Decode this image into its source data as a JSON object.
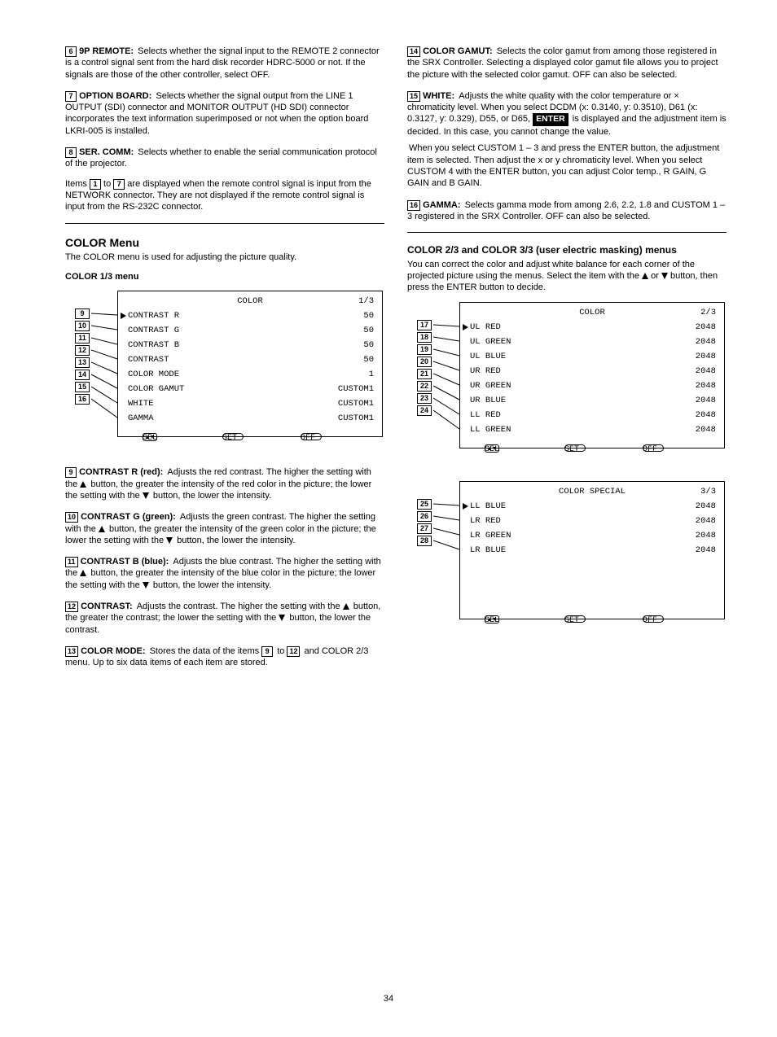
{
  "page_number": "34",
  "left": {
    "item6": {
      "num": "6",
      "lead": "9P REMOTE:",
      "body": "Selects whether the signal input to the REMOTE 2 connector is a control signal sent from the hard disk recorder HDRC-5000 or not. If the signals are those of the other controller, select OFF."
    },
    "item7": {
      "num": "7",
      "lead": "OPTION BOARD:",
      "body": "Selects whether the signal output from the LINE 1 OUTPUT (SDI) connector and MONITOR OUTPUT (HD SDI) connector incorporates the text information superimposed or not when the option board LKRI-005 is installed."
    },
    "item8": {
      "num": "8",
      "lead": "SER. COMM:",
      "body": "Selects whether to enable the serial communication protocol of the projector."
    },
    "item8_note": "Items [1] to [7] are displayed when the remote control signal is input from the NETWORK connector. They are not displayed if the remote control signal is input from the RS-232C connector.",
    "boxref1": "1",
    "boxref7": "7"
  },
  "section_color": {
    "heading": "COLOR Menu",
    "sub": "COLOR 1/3 menu",
    "note": "The COLOR menu is used for adjusting the picture quality."
  },
  "menu1": {
    "title": "COLOR",
    "page": "1/3",
    "rows": [
      {
        "num": "9",
        "k": "CONTRAST R",
        "v": "50"
      },
      {
        "num": "10",
        "k": "CONTRAST G",
        "v": "50"
      },
      {
        "num": "11",
        "k": "CONTRAST B",
        "v": "50"
      },
      {
        "num": "12",
        "k": "CONTRAST",
        "v": "50"
      },
      {
        "num": "13",
        "k": "COLOR MODE",
        "v": "1"
      },
      {
        "num": "14",
        "k": "COLOR GAMUT",
        "v": "CUSTOM1"
      },
      {
        "num": "15",
        "k": "WHITE",
        "v": "CUSTOM1"
      },
      {
        "num": "16",
        "k": "GAMMA",
        "v": "CUSTOM1"
      }
    ],
    "bottom": {
      "sel": "SEL",
      "set": "SET",
      "off": "OFF"
    }
  },
  "item9": {
    "num": "9",
    "lead": "CONTRAST R (red):",
    "body": "Adjusts the red contrast. The higher the setting with the ",
    "body2": " button, the greater the intensity of the red color in the picture; the lower the setting with the ",
    "body3": " button, the lower the intensity."
  },
  "item10": {
    "num": "10",
    "lead": "CONTRAST G (green):",
    "body": "Adjusts the green contrast. The higher the setting with the ",
    "body2": " button, the greater the intensity of the green color in the picture; the lower the setting with the ",
    "body3": " button, the lower the intensity."
  },
  "item11": {
    "num": "11",
    "lead": "CONTRAST B (blue):",
    "body": "Adjusts the blue contrast. The higher the setting with the ",
    "body2": " button, the greater the intensity of the blue color in the picture; the lower the setting with the ",
    "body3": " button, the lower the intensity."
  },
  "item12": {
    "num": "12",
    "lead": "CONTRAST:",
    "body": "Adjusts the contrast. The higher the setting with the ",
    "body2": " button, the greater the contrast; the lower the setting with the ",
    "body3": " button, the lower the contrast."
  },
  "item13": {
    "num": "13",
    "lead": "COLOR MODE:",
    "body": "Stores the data of the items ",
    "body2": " to ",
    "body3": " and COLOR 2/3 menu. Up to six data items of each item are stored."
  },
  "boxref9": "9",
  "boxref12": "12",
  "right": {
    "item14": {
      "num": "14",
      "lead": "COLOR GAMUT:",
      "body": "Selects the color gamut from among those registered in the SRX Controller. Selecting a displayed color gamut file allows you to project the picture with the selected color gamut. OFF can also be selected."
    },
    "item15": {
      "num": "15",
      "lead": "WHITE:",
      "p1_a": "Adjusts the white quality with the color temperature or ",
      "p1_b": "  chromaticity level. When you select DCDM (x: 0.3140, y: 0.3510), D61 (x: 0.3127, y: 0.329), D55, or D65, ",
      "p1_c": " is displayed and the adjustment item is decided. In this case, you cannot change the value.",
      "p2": "When you select CUSTOM 1 – 3 and press the ENTER button, the adjustment item is selected. Then adjust the x or y chromaticity level. When you select CUSTOM 4 with the ENTER button, you can adjust Color temp., R GAIN, G GAIN and B GAIN.",
      "enter": "ENTER"
    },
    "item16": {
      "num": "16",
      "lead": "GAMMA:",
      "body": "Selects gamma mode from among 2.6, 2.2, 1.8 and CUSTOM 1 – 3 registered in the SRX Controller. OFF can also be selected."
    }
  },
  "section_color23": {
    "heading": "COLOR 2/3 and COLOR 3/3 (user electric masking) menus",
    "p": "You can correct the color and adjust white balance for each corner of the projected picture using the menus. Select the item with the ",
    "p2": " or ",
    "p3": " button, then press the ENTER button to decide."
  },
  "menu2": {
    "title": "COLOR",
    "page": "2/3",
    "rows": [
      {
        "num": "17",
        "k": "UL RED",
        "v": "2048"
      },
      {
        "num": "18",
        "k": "UL GREEN",
        "v": "2048"
      },
      {
        "num": "19",
        "k": "UL BLUE",
        "v": "2048"
      },
      {
        "num": "20",
        "k": "UR RED",
        "v": "2048"
      },
      {
        "num": "21",
        "k": "UR GREEN",
        "v": "2048"
      },
      {
        "num": "22",
        "k": "UR BLUE",
        "v": "2048"
      },
      {
        "num": "23",
        "k": "LL RED",
        "v": "2048"
      },
      {
        "num": "24",
        "k": "LL GREEN",
        "v": "2048"
      }
    ],
    "bottom": {
      "sel": "SEL",
      "set": "SET",
      "off": "OFF"
    }
  },
  "menu3": {
    "title": "COLOR SPECIAL",
    "page": "3/3",
    "rows": [
      {
        "num": "25",
        "k": "LL BLUE",
        "v": "2048"
      },
      {
        "num": "26",
        "k": "LR RED",
        "v": "2048"
      },
      {
        "num": "27",
        "k": "LR GREEN",
        "v": "2048"
      },
      {
        "num": "28",
        "k": "LR BLUE",
        "v": "2048"
      }
    ],
    "bottom": {
      "sel": "SEL",
      "set": "SET",
      "off": "OFF"
    }
  }
}
